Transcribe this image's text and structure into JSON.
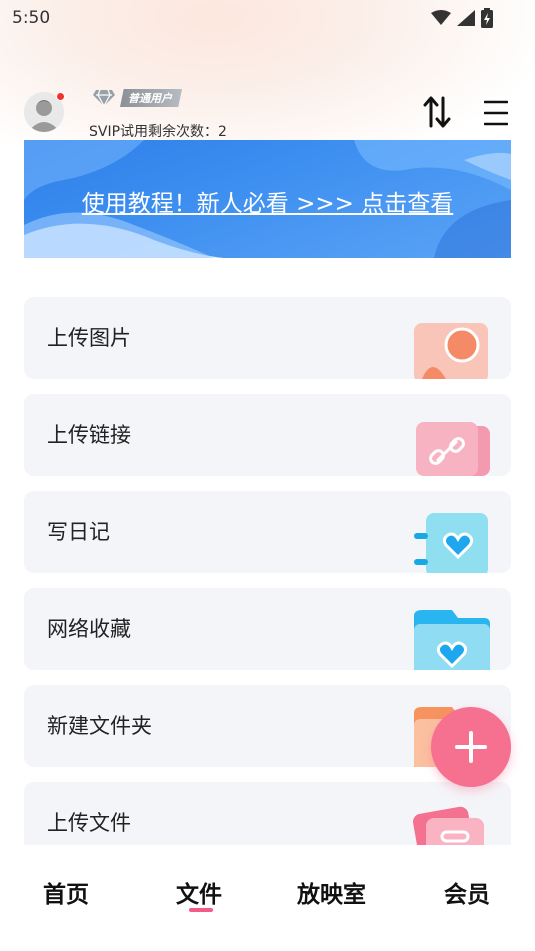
{
  "status_bar": {
    "time": "5:50",
    "icons": [
      "wifi-icon",
      "signal-icon",
      "battery-charging-icon"
    ]
  },
  "header": {
    "avatar_icon": "default-user-avatar",
    "has_notification_dot": true,
    "user_level_label": "普通用户",
    "svip_trials_text": "SVIP试用剩余次数：2",
    "sort_icon": "sort-arrows-icon",
    "menu_icon": "hamburger-menu-icon"
  },
  "banner": {
    "text": "使用教程！新人必看 >>> 点击查看"
  },
  "actions": [
    {
      "label": "上传图片",
      "icon": "upload-image-icon"
    },
    {
      "label": "上传链接",
      "icon": "link-icon"
    },
    {
      "label": "写日记",
      "icon": "diary-heart-icon"
    },
    {
      "label": "网络收藏",
      "icon": "favorite-folder-icon"
    },
    {
      "label": "新建文件夹",
      "icon": "new-folder-icon"
    },
    {
      "label": "上传文件",
      "icon": "upload-file-icon"
    }
  ],
  "fab": {
    "icon": "plus-icon"
  },
  "bottom_nav": {
    "items": [
      {
        "label": "首页"
      },
      {
        "label": "文件"
      },
      {
        "label": "放映室"
      },
      {
        "label": "会员"
      }
    ],
    "active": "文件"
  },
  "colors": {
    "accent_pink": "#f6708f",
    "banner_blue": "#3c8ef0",
    "card_bg": "#f4f5f9",
    "notification_red": "#f0322c"
  }
}
